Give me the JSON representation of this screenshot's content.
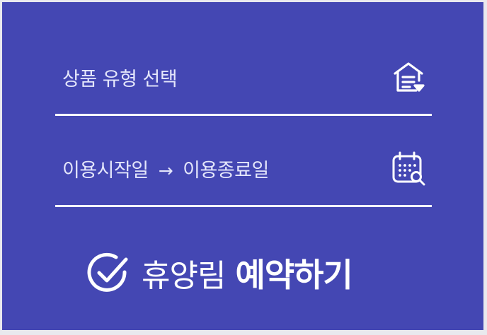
{
  "product_type": {
    "label": "상품 유형 선택",
    "icon": "house-list-icon"
  },
  "date_range": {
    "start_label": "이용시작일",
    "arrow": "→",
    "end_label": "이용종료일",
    "icon": "calendar-search-icon"
  },
  "reserve": {
    "prefix": "휴양림",
    "action": "예약하기",
    "icon": "check-circle-icon"
  },
  "colors": {
    "panel": "#4447b3",
    "text": "#e4e6fb",
    "divider": "#ffffff"
  }
}
